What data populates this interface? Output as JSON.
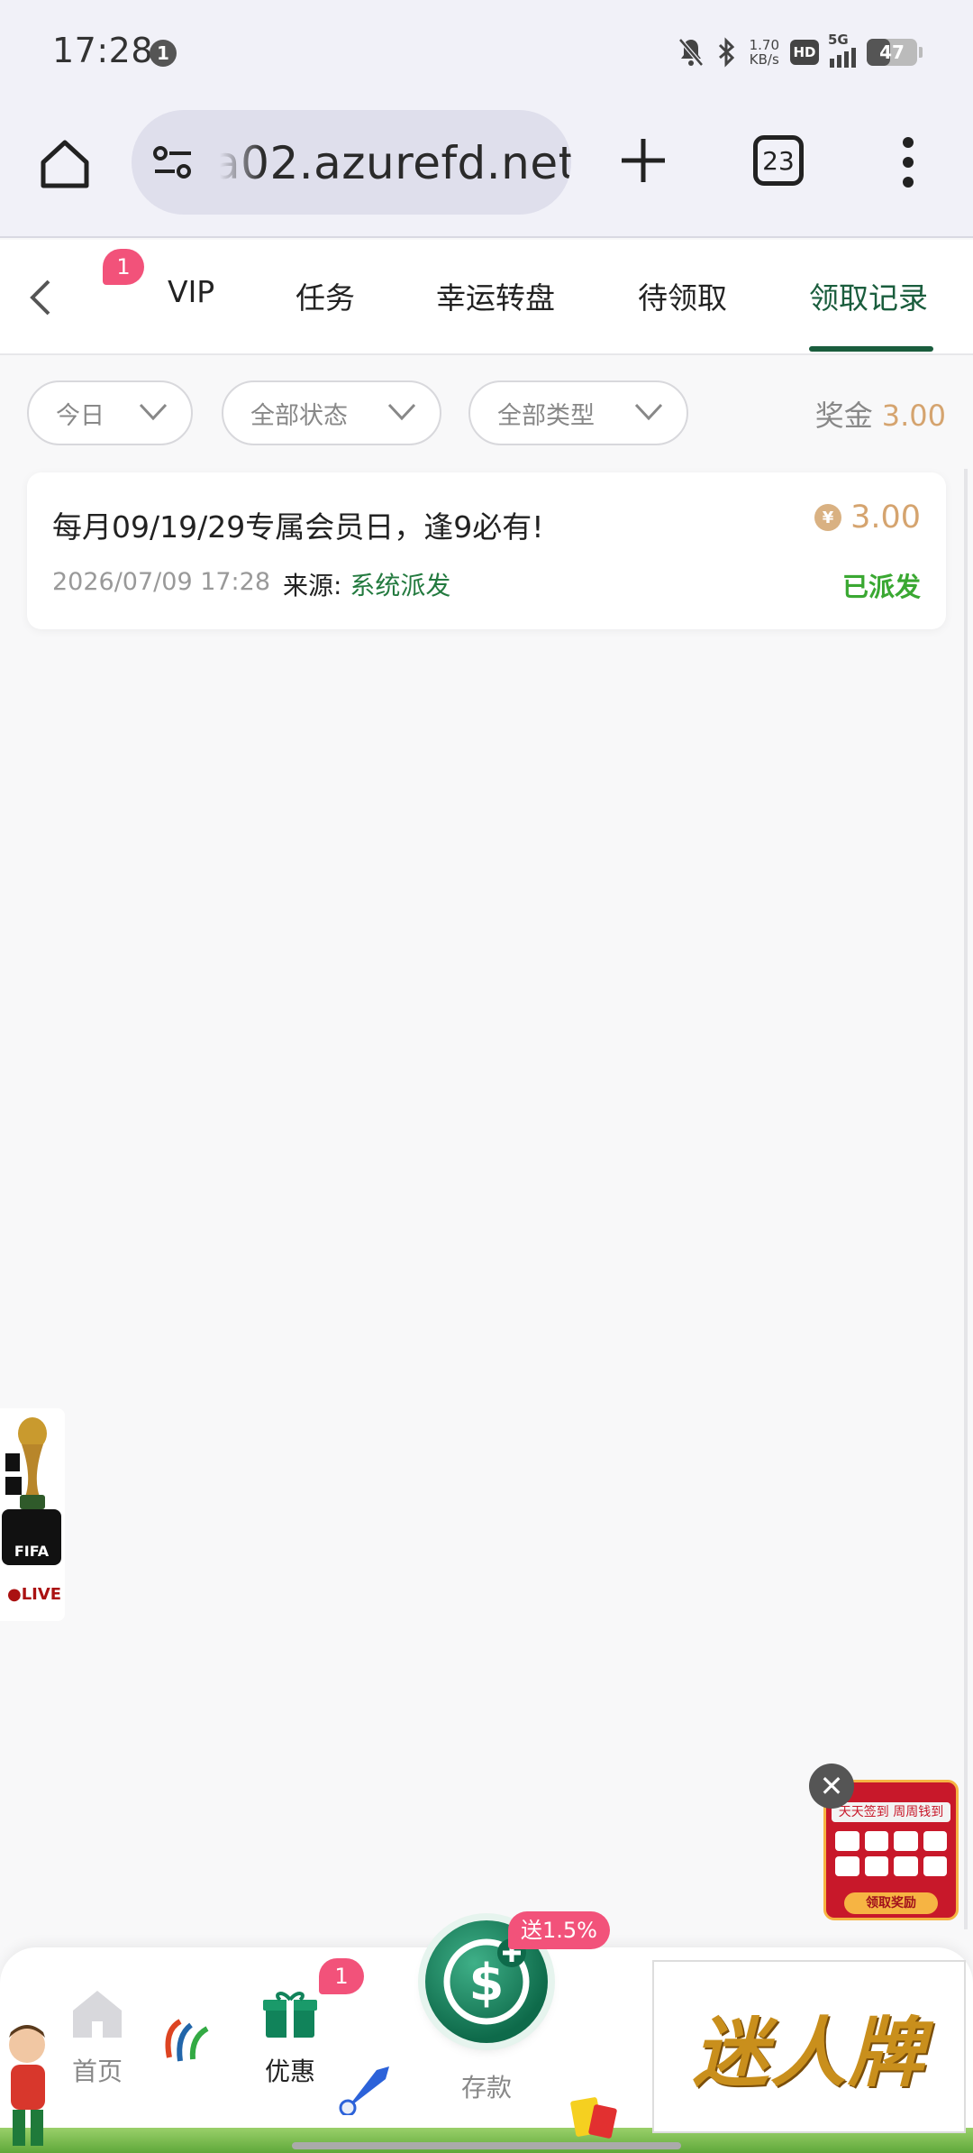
{
  "status_bar": {
    "time": "17:28",
    "notification_count": "1",
    "net_speed_value": "1.70",
    "net_speed_unit": "KB/s",
    "hd_label": "HD",
    "network_label": "5G",
    "battery_level": "47",
    "battery_fraction": 0.47
  },
  "browser": {
    "url": "a02.azurefd.net",
    "tab_count": "23",
    "icons": [
      "home-icon",
      "site-settings-icon",
      "new-tab-plus-icon",
      "tab-switcher-icon",
      "more-menu-icon"
    ]
  },
  "nav": {
    "badge": "1",
    "tabs": [
      "VIP",
      "任务",
      "幸运转盘",
      "待领取",
      "领取记录"
    ],
    "active_tab": "领取记录"
  },
  "filters": {
    "date": "今日",
    "status": "全部状态",
    "type": "全部类型",
    "bonus_label": "奖金",
    "bonus_total": "3.00"
  },
  "records": [
    {
      "title": "每月09/19/29专属会员日，逢9必有!",
      "amount": "3.00",
      "currency_symbol": "¥",
      "time": "2026/07/09 17:28",
      "source_label": "来源:",
      "source": "系统派发",
      "status": "已派发"
    }
  ],
  "fifa_widget": {
    "badge": "FIFA",
    "live": "●LIVE"
  },
  "signin_widget": {
    "close": "✕",
    "title": "天天签到 周周钱到",
    "button": "领取奖励"
  },
  "bottom_nav": {
    "home": "首页",
    "promo": "优惠",
    "promo_badge": "1",
    "deposit": "存款",
    "deposit_tag": "送1.5%",
    "brand": "迷人牌"
  },
  "colors": {
    "accent_green": "#1a5d3d",
    "status_green": "#3aa832",
    "amount_gold": "#d5a46f",
    "badge_pink": "#f2527a"
  }
}
